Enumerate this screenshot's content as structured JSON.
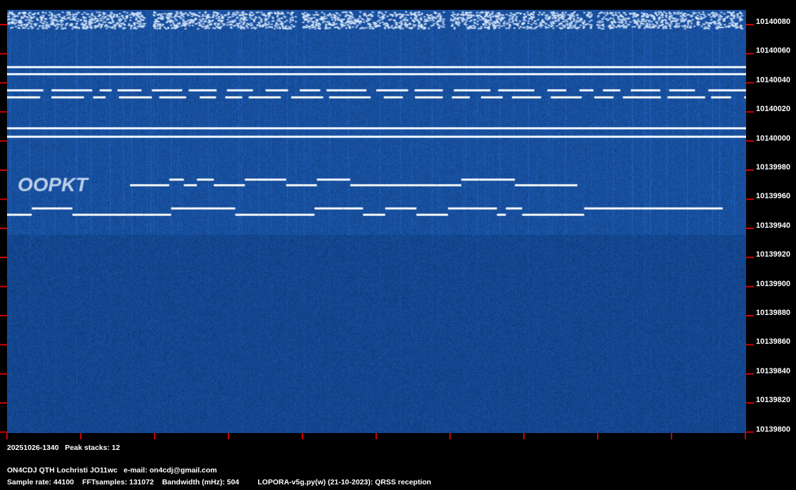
{
  "colors": {
    "background": "#0d3a7a",
    "signal": "#ffffff",
    "tick": "#d00000"
  },
  "freq_axis": {
    "labels": [
      "10140080",
      "10140060",
      "10140040",
      "10140020",
      "10140000",
      "10139980",
      "10139960",
      "10139940",
      "10139920",
      "10139900",
      "10139880",
      "10139860",
      "10139840",
      "10139820",
      "10139800"
    ]
  },
  "footer": {
    "timestamp": "20251026-1340",
    "peak_stacks": "Peak stacks: 12",
    "station": "ON4CDJ QTH Lochristi JO11wc",
    "email": "e-mail: on4cdj@gmail.com",
    "sample_rate": "Sample rate: 44100",
    "fft_samples": "FFTsamples: 131072",
    "bandwidth": "Bandwidth (mHz): 504",
    "software": "LOPORA-v5g.py(w) (21-10-2023): QRSS reception"
  }
}
